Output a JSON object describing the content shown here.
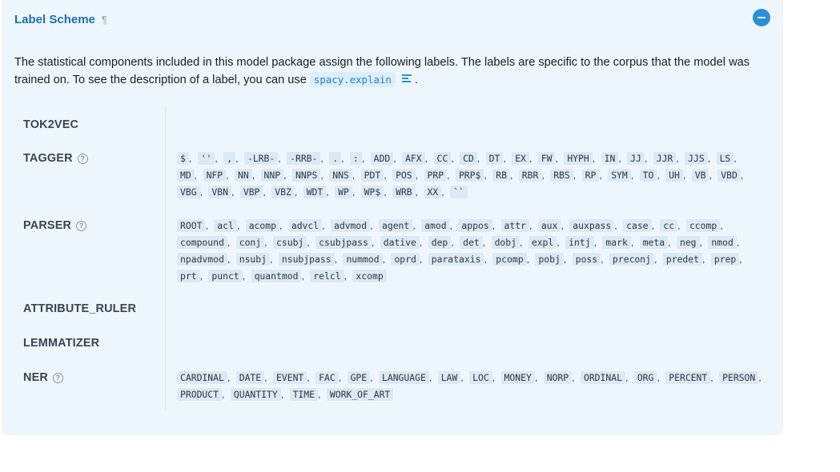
{
  "header": {
    "title": "Label Scheme",
    "anchor": "¶"
  },
  "intro": {
    "text_before": "The statistical components included in this model package assign the following labels. The labels are specific to the corpus that the model was trained on. To see the description of a label, you can use ",
    "code": "spacy.explain",
    "text_after": "."
  },
  "components": [
    {
      "name": "TOK2VEC",
      "help": false,
      "labels": []
    },
    {
      "name": "TAGGER",
      "help": true,
      "labels": [
        "$",
        "''",
        ",",
        "-LRB-",
        "-RRB-",
        ".",
        ":",
        "ADD",
        "AFX",
        "CC",
        "CD",
        "DT",
        "EX",
        "FW",
        "HYPH",
        "IN",
        "JJ",
        "JJR",
        "JJS",
        "LS",
        "MD",
        "NFP",
        "NN",
        "NNP",
        "NNPS",
        "NNS",
        "PDT",
        "POS",
        "PRP",
        "PRP$",
        "RB",
        "RBR",
        "RBS",
        "RP",
        "SYM",
        "TO",
        "UH",
        "VB",
        "VBD",
        "VBG",
        "VBN",
        "VBP",
        "VBZ",
        "WDT",
        "WP",
        "WP$",
        "WRB",
        "XX",
        "``"
      ]
    },
    {
      "name": "PARSER",
      "help": true,
      "labels": [
        "ROOT",
        "acl",
        "acomp",
        "advcl",
        "advmod",
        "agent",
        "amod",
        "appos",
        "attr",
        "aux",
        "auxpass",
        "case",
        "cc",
        "ccomp",
        "compound",
        "conj",
        "csubj",
        "csubjpass",
        "dative",
        "dep",
        "det",
        "dobj",
        "expl",
        "intj",
        "mark",
        "meta",
        "neg",
        "nmod",
        "npadvmod",
        "nsubj",
        "nsubjpass",
        "nummod",
        "oprd",
        "parataxis",
        "pcomp",
        "pobj",
        "poss",
        "preconj",
        "predet",
        "prep",
        "prt",
        "punct",
        "quantmod",
        "relcl",
        "xcomp"
      ]
    },
    {
      "name": "ATTRIBUTE_RULER",
      "help": false,
      "labels": []
    },
    {
      "name": "LEMMATIZER",
      "help": false,
      "labels": []
    },
    {
      "name": "NER",
      "help": true,
      "labels": [
        "CARDINAL",
        "DATE",
        "EVENT",
        "FAC",
        "GPE",
        "LANGUAGE",
        "LAW",
        "LOC",
        "MONEY",
        "NORP",
        "ORDINAL",
        "ORG",
        "PERCENT",
        "PERSON",
        "PRODUCT",
        "QUANTITY",
        "TIME",
        "WORK_OF_ART"
      ]
    }
  ],
  "colors": {
    "accent": "#2a8fd6",
    "panel_bg": "#eef6fd",
    "label_bg": "#dbe9f4"
  },
  "icons": {
    "collapse": "minus-circle-icon",
    "docs": "list-icon",
    "help": "question-circle-icon"
  }
}
